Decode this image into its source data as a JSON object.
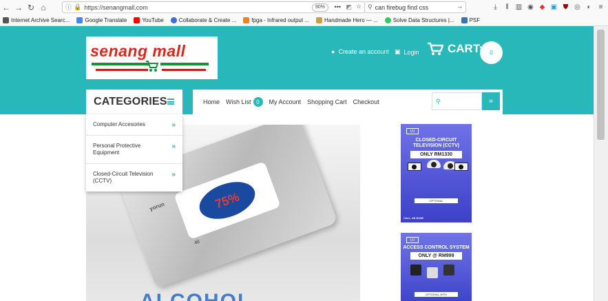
{
  "browser": {
    "url": "https://senangmall.com",
    "zoom": "90%",
    "search_query": "can firebug find css",
    "bookmarks": [
      {
        "label": "Internet Archive Searc...",
        "color": "#555555"
      },
      {
        "label": "Google Translate",
        "color": "#4285f4"
      },
      {
        "label": "YouTube",
        "color": "#ff0000"
      },
      {
        "label": "Collaborate & Create ...",
        "color": "#3d6fd6"
      },
      {
        "label": "fpga - Infrared output ...",
        "color": "#f48024"
      },
      {
        "label": "Handmade Hero — ...",
        "color": "#caa23a"
      },
      {
        "label": "Solve Data Structures |...",
        "color": "#2ec866"
      },
      {
        "label": "PSF",
        "color": "#3776ab"
      }
    ]
  },
  "site": {
    "logo_text": "senang mall",
    "accent_color": "#29b8b9",
    "create_account": "Create an account",
    "login": "Login",
    "cart_label": "CART:",
    "cart_count": "0"
  },
  "categories": {
    "title": "CATEGORIES",
    "items": [
      {
        "label": "Computer Accesories"
      },
      {
        "label": "Personal Protective Equipment"
      },
      {
        "label": "Closed-Circuit Television (CCTV)"
      }
    ]
  },
  "menu": {
    "home": "Home",
    "wish_list": "Wish List",
    "wish_count": "0",
    "my_account": "My Account",
    "shopping_cart": "Shopping Cart",
    "checkout": "Checkout"
  },
  "product": {
    "brand": "yorun",
    "pack_highlight": "75%",
    "pack_count": "40",
    "bottom_text": "ALCOHOL"
  },
  "ads": {
    "cctv": {
      "title": "CLOSED-CIRCUIT TELEVISION (CCTV)",
      "price": "ONLY RM1330",
      "optional": "OPTIONAL",
      "call": "CALL US NOW!"
    },
    "access": {
      "title": "ACCESS CONTROL SYSTEM",
      "price": "ONLY @ RM999",
      "optional": "OPTIONAL WITH"
    }
  }
}
